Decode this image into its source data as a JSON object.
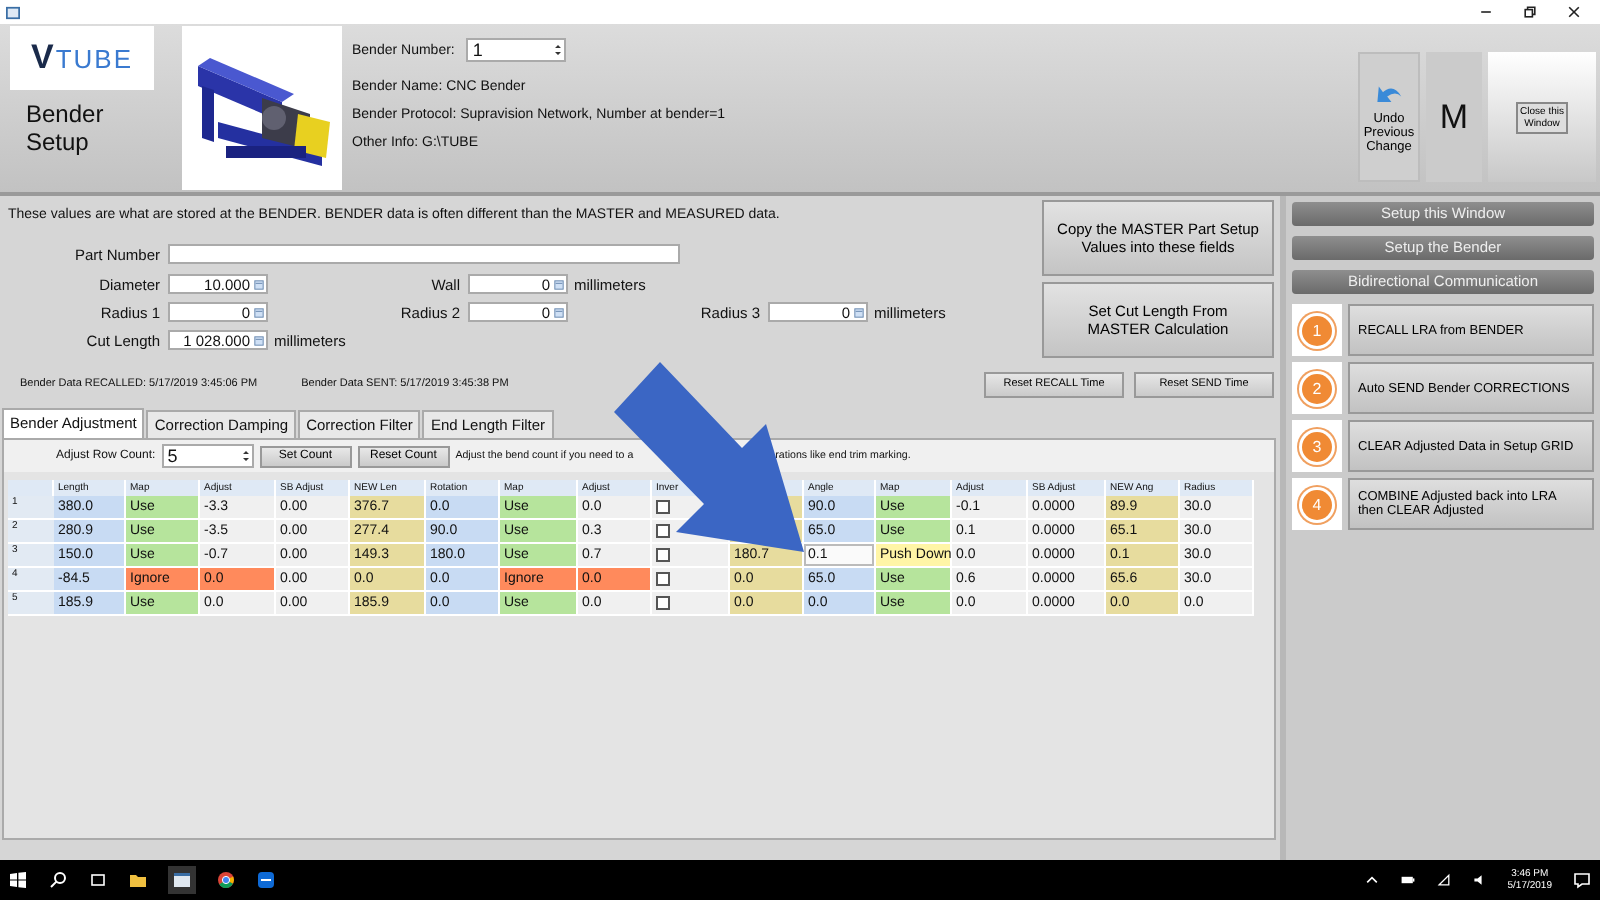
{
  "header": {
    "logo": [
      "V",
      "TUBE"
    ],
    "title": "Bender Setup",
    "bender_number": {
      "label": "Bender Number:",
      "value": "1"
    },
    "info": [
      "Bender Name:  CNC Bender",
      "Bender Protocol:  Supravision Network, Number at bender=1",
      "Other Info:  G:\\TUBE"
    ],
    "undo_button": "Undo Previous Change",
    "mode_letter": "M",
    "close_button": "Close this Window"
  },
  "form": {
    "description": "These values are what are stored at the BENDER.  BENDER data is often different than the MASTER and MEASURED data.",
    "part_number": {
      "label": "Part Number"
    },
    "rows": [
      [
        {
          "label": "Diameter",
          "value": "10.000"
        },
        {
          "label": "Wall",
          "value": "0",
          "unit": "millimeters"
        }
      ],
      [
        {
          "label": "Radius 1",
          "value": "0"
        },
        {
          "label": "Radius 2",
          "value": "0"
        },
        {
          "label": "Radius 3",
          "value": "0",
          "unit": "millimeters"
        }
      ],
      [
        {
          "label": "Cut Length",
          "value": "1 028.000",
          "unit": "millimeters"
        }
      ]
    ],
    "actions": [
      "Copy the MASTER Part Setup Values into these fields",
      "Set Cut Length From MASTER Calculation"
    ],
    "timestamps": [
      "Bender Data RECALLED:  5/17/2019 3:45:06 PM",
      "Bender Data SENT:  5/17/2019 3:45:38 PM"
    ],
    "reset_buttons": [
      "Reset RECALL Time",
      "Reset SEND Time"
    ]
  },
  "tabs": [
    {
      "label": "Bender Adjustment",
      "selected": true
    },
    {
      "label": "Correction Damping",
      "selected": false
    },
    {
      "label": "Correction Filter",
      "selected": false
    },
    {
      "label": "End Length Filter",
      "selected": false
    }
  ],
  "row_count": {
    "label": "Adjust Row Count:",
    "value": "5"
  },
  "count_buttons": [
    "Set Count",
    "Reset Count"
  ],
  "hint_parts": [
    "Adjust the bend count if you need to a",
    "rations like end trim marking."
  ],
  "grid": {
    "columns": [
      {
        "label": "Length"
      },
      {
        "label": "Map"
      },
      {
        "label": "Adjust"
      },
      {
        "label": "SB Adjust"
      },
      {
        "label": "NEW Len"
      },
      {
        "label": "Rotation"
      },
      {
        "label": "Map"
      },
      {
        "label": "Adjust"
      },
      {
        "label": "Inver"
      },
      {},
      {
        "label": "Angle"
      },
      {
        "label": "Map"
      },
      {
        "label": "Adjust"
      },
      {
        "label": "SB Adjust"
      },
      {
        "label": "NEW Ang"
      },
      {
        "label": "Radius"
      }
    ],
    "rows": [
      {
        "number": "1",
        "cells": [
          {
            "text": "380.0",
            "kind": "measured"
          },
          {
            "text": "Use",
            "kind": "use"
          },
          {
            "text": "-3.3",
            "kind": "plain"
          },
          {
            "text": "0.00",
            "kind": "plain"
          },
          {
            "text": "376.7",
            "kind": "result"
          },
          {
            "text": "0.0",
            "kind": "measured"
          },
          {
            "text": "Use",
            "kind": "use"
          },
          {
            "text": "0.0",
            "kind": "plain"
          },
          {
            "kind": "check",
            "checked": false
          },
          {
            "kind": "result"
          },
          {
            "text": "90.0",
            "kind": "measured"
          },
          {
            "text": "Use",
            "kind": "use"
          },
          {
            "text": "-0.1",
            "kind": "plain"
          },
          {
            "text": "0.0000",
            "kind": "plain"
          },
          {
            "text": "89.9",
            "kind": "result"
          },
          {
            "text": "30.0",
            "kind": "plain"
          }
        ]
      },
      {
        "number": "2",
        "cells": [
          {
            "text": "280.9",
            "kind": "measured"
          },
          {
            "text": "Use",
            "kind": "use"
          },
          {
            "text": "-3.5",
            "kind": "plain"
          },
          {
            "text": "0.00",
            "kind": "plain"
          },
          {
            "text": "277.4",
            "kind": "result"
          },
          {
            "text": "90.0",
            "kind": "measured"
          },
          {
            "text": "Use",
            "kind": "use"
          },
          {
            "text": "0.3",
            "kind": "plain"
          },
          {
            "kind": "check",
            "checked": false
          },
          {
            "kind": "result"
          },
          {
            "text": "65.0",
            "kind": "measured"
          },
          {
            "text": "Use",
            "kind": "use"
          },
          {
            "text": "0.1",
            "kind": "plain"
          },
          {
            "text": "0.0000",
            "kind": "plain"
          },
          {
            "text": "65.1",
            "kind": "result"
          },
          {
            "text": "30.0",
            "kind": "plain"
          }
        ]
      },
      {
        "number": "3",
        "cells": [
          {
            "text": "150.0",
            "kind": "measured"
          },
          {
            "text": "Use",
            "kind": "use"
          },
          {
            "text": "-0.7",
            "kind": "plain"
          },
          {
            "text": "0.00",
            "kind": "plain"
          },
          {
            "text": "149.3",
            "kind": "result"
          },
          {
            "text": "180.0",
            "kind": "measured"
          },
          {
            "text": "Use",
            "kind": "use"
          },
          {
            "text": "0.7",
            "kind": "plain"
          },
          {
            "kind": "check",
            "checked": false
          },
          {
            "text": "180.7",
            "kind": "result"
          },
          {
            "text": "0.1",
            "kind": "edit"
          },
          {
            "text": "Push Down",
            "kind": "push"
          },
          {
            "text": "0.0",
            "kind": "plain"
          },
          {
            "text": "0.0000",
            "kind": "plain"
          },
          {
            "text": "0.1",
            "kind": "result"
          },
          {
            "text": "30.0",
            "kind": "plain"
          }
        ]
      },
      {
        "number": "4",
        "cells": [
          {
            "text": "-84.5",
            "kind": "measured"
          },
          {
            "text": "Ignore",
            "kind": "ignore"
          },
          {
            "text": "0.0",
            "kind": "ignore"
          },
          {
            "text": "0.00",
            "kind": "plain"
          },
          {
            "text": "0.0",
            "kind": "result"
          },
          {
            "text": "0.0",
            "kind": "measured"
          },
          {
            "text": "Ignore",
            "kind": "ignore"
          },
          {
            "text": "0.0",
            "kind": "ignore"
          },
          {
            "kind": "check",
            "checked": false
          },
          {
            "text": "0.0",
            "kind": "result"
          },
          {
            "text": "65.0",
            "kind": "measured"
          },
          {
            "text": "Use",
            "kind": "use"
          },
          {
            "text": "0.6",
            "kind": "plain"
          },
          {
            "text": "0.0000",
            "kind": "plain"
          },
          {
            "text": "65.6",
            "kind": "result"
          },
          {
            "text": "30.0",
            "kind": "plain"
          }
        ]
      },
      {
        "number": "5",
        "cells": [
          {
            "text": "185.9",
            "kind": "measured"
          },
          {
            "text": "Use",
            "kind": "use"
          },
          {
            "text": "0.0",
            "kind": "plain"
          },
          {
            "text": "0.00",
            "kind": "plain"
          },
          {
            "text": "185.9",
            "kind": "result"
          },
          {
            "text": "0.0",
            "kind": "measured"
          },
          {
            "text": "Use",
            "kind": "use"
          },
          {
            "text": "0.0",
            "kind": "plain"
          },
          {
            "kind": "check",
            "checked": false
          },
          {
            "text": "0.0",
            "kind": "result"
          },
          {
            "text": "0.0",
            "kind": "measured"
          },
          {
            "text": "Use",
            "kind": "use"
          },
          {
            "text": "0.0",
            "kind": "plain"
          },
          {
            "text": "0.0000",
            "kind": "plain"
          },
          {
            "text": "0.0",
            "kind": "result"
          },
          {
            "text": "0.0",
            "kind": "plain"
          }
        ]
      }
    ]
  },
  "side_panel": {
    "sections": [
      "Setup this Window",
      "Setup the Bender",
      "Bidirectional Communication"
    ],
    "steps": [
      {
        "number": "1",
        "label": "RECALL LRA from BENDER"
      },
      {
        "number": "2",
        "label": "Auto SEND Bender CORRECTIONS"
      },
      {
        "number": "3",
        "label": "CLEAR Adjusted Data in Setup GRID"
      },
      {
        "number": "4",
        "label": "COMBINE Adjusted back into LRA then CLEAR Adjusted"
      }
    ]
  },
  "taskbar": {
    "time": "3:46 PM",
    "date": "5/17/2019"
  }
}
